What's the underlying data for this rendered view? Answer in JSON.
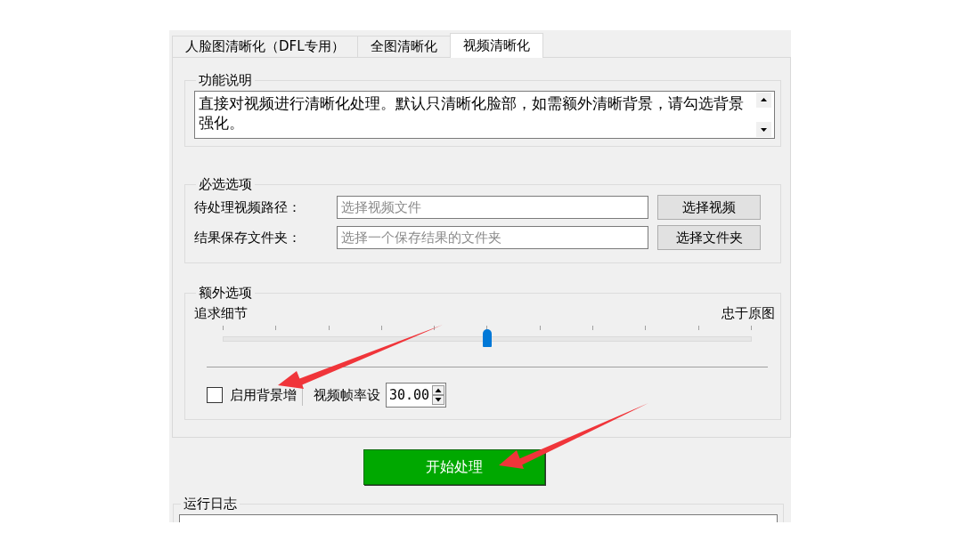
{
  "tabs": [
    {
      "label": "人脸图清晰化（DFL专用）",
      "selected": false
    },
    {
      "label": "全图清晰化",
      "selected": false
    },
    {
      "label": "视频清晰化",
      "selected": true
    }
  ],
  "description": {
    "title": "功能说明",
    "text": "直接对视频进行清晰化处理。默认只清晰化脸部，如需额外清晰背景，请勾选背景强化。"
  },
  "required": {
    "title": "必选选项",
    "rows": [
      {
        "label": "待处理视频路径：",
        "placeholder": "选择视频文件",
        "button": "选择视频"
      },
      {
        "label": "结果保存文件夹：",
        "placeholder": "选择一个保存结果的文件夹",
        "button": "选择文件夹"
      }
    ]
  },
  "extra": {
    "title": "额外选项",
    "slider": {
      "left_label": "追求细节",
      "right_label": "忠于原图",
      "level": 0.5
    },
    "checkbox": {
      "label": "启用背景增",
      "checked": false
    },
    "fps": {
      "label": "视频帧率设",
      "value": "30.00"
    }
  },
  "start_button": "开始处理",
  "log": {
    "title": "运行日志"
  }
}
